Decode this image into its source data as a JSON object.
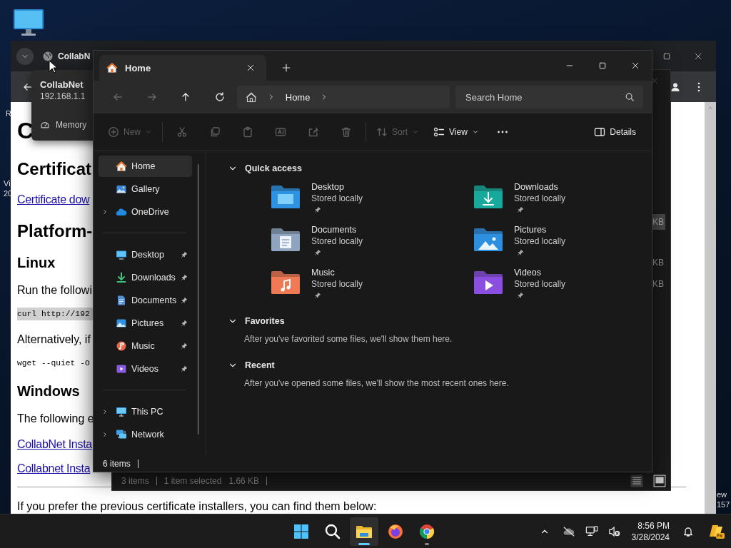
{
  "desktop": {
    "left_fragments": [
      "R",
      "Vi",
      "20"
    ],
    "right_fragments": [
      "ew",
      "157"
    ]
  },
  "browser": {
    "tab": {
      "title": "CollabN"
    },
    "page": [
      {
        "kind": "h1",
        "text": "C"
      },
      {
        "kind": "h2",
        "text": "Certificat"
      },
      {
        "kind": "link",
        "text": "Certificate dow"
      },
      {
        "kind": "h2",
        "text": "Platform-"
      },
      {
        "kind": "h3",
        "text": "Linux"
      },
      {
        "kind": "p",
        "text": "Run the followi"
      },
      {
        "kind": "code",
        "text": "curl http://192",
        "highlighted": true
      },
      {
        "kind": "p",
        "text": "Alternatively, if"
      },
      {
        "kind": "code",
        "text": "wget --quiet -O",
        "highlighted": false
      },
      {
        "kind": "h3",
        "text": "Windows"
      },
      {
        "kind": "p",
        "text": "The following e"
      },
      {
        "kind": "link",
        "text": "CollabNet Insta"
      },
      {
        "kind": "link",
        "text": "Collabnet Insta"
      },
      {
        "kind": "hr"
      },
      {
        "kind": "p",
        "text": "If you prefer the previous certificate installers, you can find them below:"
      }
    ]
  },
  "tooltip": {
    "title": "CollabNet",
    "address": "192.168.1.1",
    "item": "Memory"
  },
  "back_explorer": {
    "fragments": [
      {
        "text": "KB",
        "selected": true
      },
      {
        "text": "KB",
        "selected": false
      },
      {
        "text": "KB",
        "selected": false
      }
    ],
    "status": [
      "3 items",
      "1 item selected",
      "1.66 KB"
    ]
  },
  "explorer": {
    "tab": {
      "title": "Home"
    },
    "nav": [
      {
        "disabled": true
      },
      {
        "disabled": true
      },
      {
        "disabled": false
      },
      {
        "disabled": false
      }
    ],
    "address": {
      "crumbs": [
        "Home"
      ]
    },
    "search": {
      "placeholder": "Search Home"
    },
    "toolbar": [
      {
        "kind": "labeled",
        "label": "New",
        "dropdown": true,
        "disabled": true
      },
      {
        "kind": "separator"
      },
      {
        "kind": "icon",
        "disabled": true
      },
      {
        "kind": "icon",
        "disabled": true
      },
      {
        "kind": "icon",
        "disabled": true
      },
      {
        "kind": "icon",
        "disabled": true
      },
      {
        "kind": "icon",
        "disabled": true
      },
      {
        "kind": "icon",
        "disabled": true
      },
      {
        "kind": "separator"
      },
      {
        "kind": "labeled",
        "label": "Sort",
        "dropdown": true,
        "disabled": true
      },
      {
        "kind": "labeled",
        "label": "View",
        "dropdown": true,
        "disabled": false
      },
      {
        "kind": "icon",
        "disabled": false
      },
      {
        "kind": "pane",
        "label": "Details",
        "dropdown": false,
        "disabled": false
      }
    ],
    "sidebar": [
      {
        "items": [
          {
            "label": "Home",
            "kind": "home",
            "selected": true,
            "pinned": false
          },
          {
            "label": "Gallery",
            "kind": "gallery",
            "selected": false,
            "pinned": false
          },
          {
            "label": "OneDrive",
            "kind": "cloud",
            "selected": false,
            "pinned": false,
            "expanded": false
          }
        ]
      },
      {
        "items": [
          {
            "label": "Desktop",
            "kind": "desktop",
            "selected": false,
            "pinned": true
          },
          {
            "label": "Downloads",
            "kind": "downloads",
            "selected": false,
            "pinned": true
          },
          {
            "label": "Documents",
            "kind": "documents",
            "selected": false,
            "pinned": true
          },
          {
            "label": "Pictures",
            "kind": "pictures",
            "selected": false,
            "pinned": true
          },
          {
            "label": "Music",
            "kind": "music",
            "selected": false,
            "pinned": true
          },
          {
            "label": "Videos",
            "kind": "videos",
            "selected": false,
            "pinned": true
          }
        ]
      },
      {
        "items": [
          {
            "label": "This PC",
            "kind": "pc",
            "selected": false,
            "pinned": false,
            "expanded": false
          },
          {
            "label": "Network",
            "kind": "network",
            "selected": false,
            "pinned": false,
            "expanded": false
          }
        ]
      }
    ],
    "sections": [
      {
        "title": "Quick access",
        "expanded": true,
        "tiles": [
          {
            "name": "Desktop",
            "detail": "Stored locally",
            "kind": "desktop",
            "pinned": true
          },
          {
            "name": "Downloads",
            "detail": "Stored locally",
            "kind": "downloads",
            "pinned": true
          },
          {
            "name": "Documents",
            "detail": "Stored locally",
            "kind": "documents",
            "pinned": true
          },
          {
            "name": "Pictures",
            "detail": "Stored locally",
            "kind": "pictures",
            "pinned": true
          },
          {
            "name": "Music",
            "detail": "Stored locally",
            "kind": "music",
            "pinned": true
          },
          {
            "name": "Videos",
            "detail": "Stored locally",
            "kind": "videos",
            "pinned": true
          }
        ]
      },
      {
        "title": "Favorites",
        "expanded": true,
        "message": "After you've favorited some files, we'll show them here."
      },
      {
        "title": "Recent",
        "expanded": true,
        "message": "After you've opened some files, we'll show the most recent ones here."
      }
    ],
    "status": {
      "count": "6 items"
    }
  },
  "taskbar": {
    "apps": [
      {
        "kind": "start",
        "active": false,
        "running": false
      },
      {
        "kind": "search",
        "active": false,
        "running": false
      },
      {
        "kind": "files",
        "active": true,
        "running": true
      },
      {
        "kind": "firefox",
        "active": false,
        "running": false
      },
      {
        "kind": "chrome",
        "active": false,
        "running": true
      }
    ],
    "time": "8:56 PM",
    "date": "3/28/2024"
  }
}
